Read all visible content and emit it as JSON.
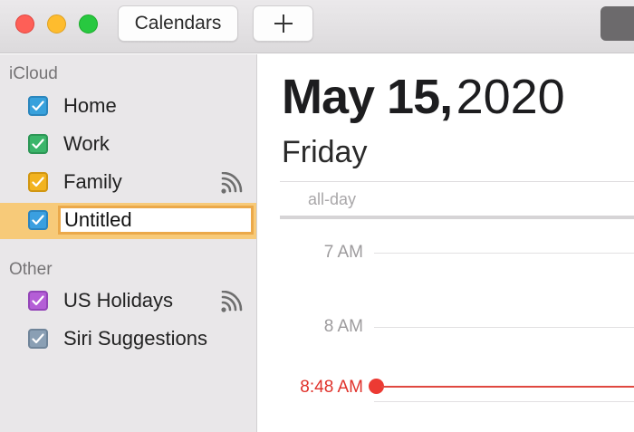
{
  "toolbar": {
    "calendars_label": "Calendars",
    "add_label": "+"
  },
  "sidebar": {
    "sections": [
      {
        "header": "iCloud",
        "items": [
          {
            "label": "Home",
            "checked": true,
            "color": "#38a1dc",
            "shared": false
          },
          {
            "label": "Work",
            "checked": true,
            "color": "#3bb56a",
            "shared": false
          },
          {
            "label": "Family",
            "checked": true,
            "color": "#f2b31f",
            "shared": true
          },
          {
            "label": "Untitled",
            "checked": true,
            "color": "#3a9fe0",
            "editing": true,
            "selected": true
          }
        ]
      },
      {
        "header": "Other",
        "items": [
          {
            "label": "US Holidays",
            "checked": true,
            "color": "#b45ed6",
            "shared": true
          },
          {
            "label": "Siri Suggestions",
            "checked": true,
            "color": "#8a9fb4",
            "shared": false
          }
        ]
      }
    ]
  },
  "day_view": {
    "month_day": "May 15,",
    "year": "2020",
    "weekday": "Friday",
    "all_day_label": "all-day",
    "hours": [
      "7 AM",
      "8 AM"
    ],
    "current_time": "8:48 AM",
    "current_time_color": "#e0312a"
  }
}
